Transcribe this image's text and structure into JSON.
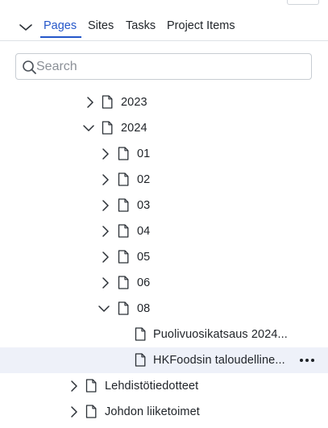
{
  "tabs": [
    {
      "label": "Pages",
      "active": true
    },
    {
      "label": "Sites",
      "active": false
    },
    {
      "label": "Tasks",
      "active": false
    },
    {
      "label": "Project Items",
      "active": false
    }
  ],
  "search": {
    "placeholder": "Search",
    "value": ""
  },
  "tree": [
    {
      "label": "2023",
      "expanded": false
    },
    {
      "label": "2024",
      "expanded": true
    },
    {
      "label": "01",
      "expanded": false
    },
    {
      "label": "02",
      "expanded": false
    },
    {
      "label": "03",
      "expanded": false
    },
    {
      "label": "04",
      "expanded": false
    },
    {
      "label": "05",
      "expanded": false
    },
    {
      "label": "06",
      "expanded": false
    },
    {
      "label": "08",
      "expanded": true
    },
    {
      "label": "Puolivuosikatsaus 2024..."
    },
    {
      "label": "HKFoodsin taloudelline...",
      "selected": true
    },
    {
      "label": "Lehdistötiedotteet",
      "expanded": false
    },
    {
      "label": "Johdon liiketoimet",
      "expanded": false
    }
  ],
  "colors": {
    "accent": "#2456c9",
    "selected_row": "#eef1f9",
    "border": "#c7ccd2"
  },
  "icons": {
    "collapse": "chevron-down-icon",
    "search": "search-icon",
    "page": "page-icon",
    "more": "more-horizontal-icon"
  }
}
